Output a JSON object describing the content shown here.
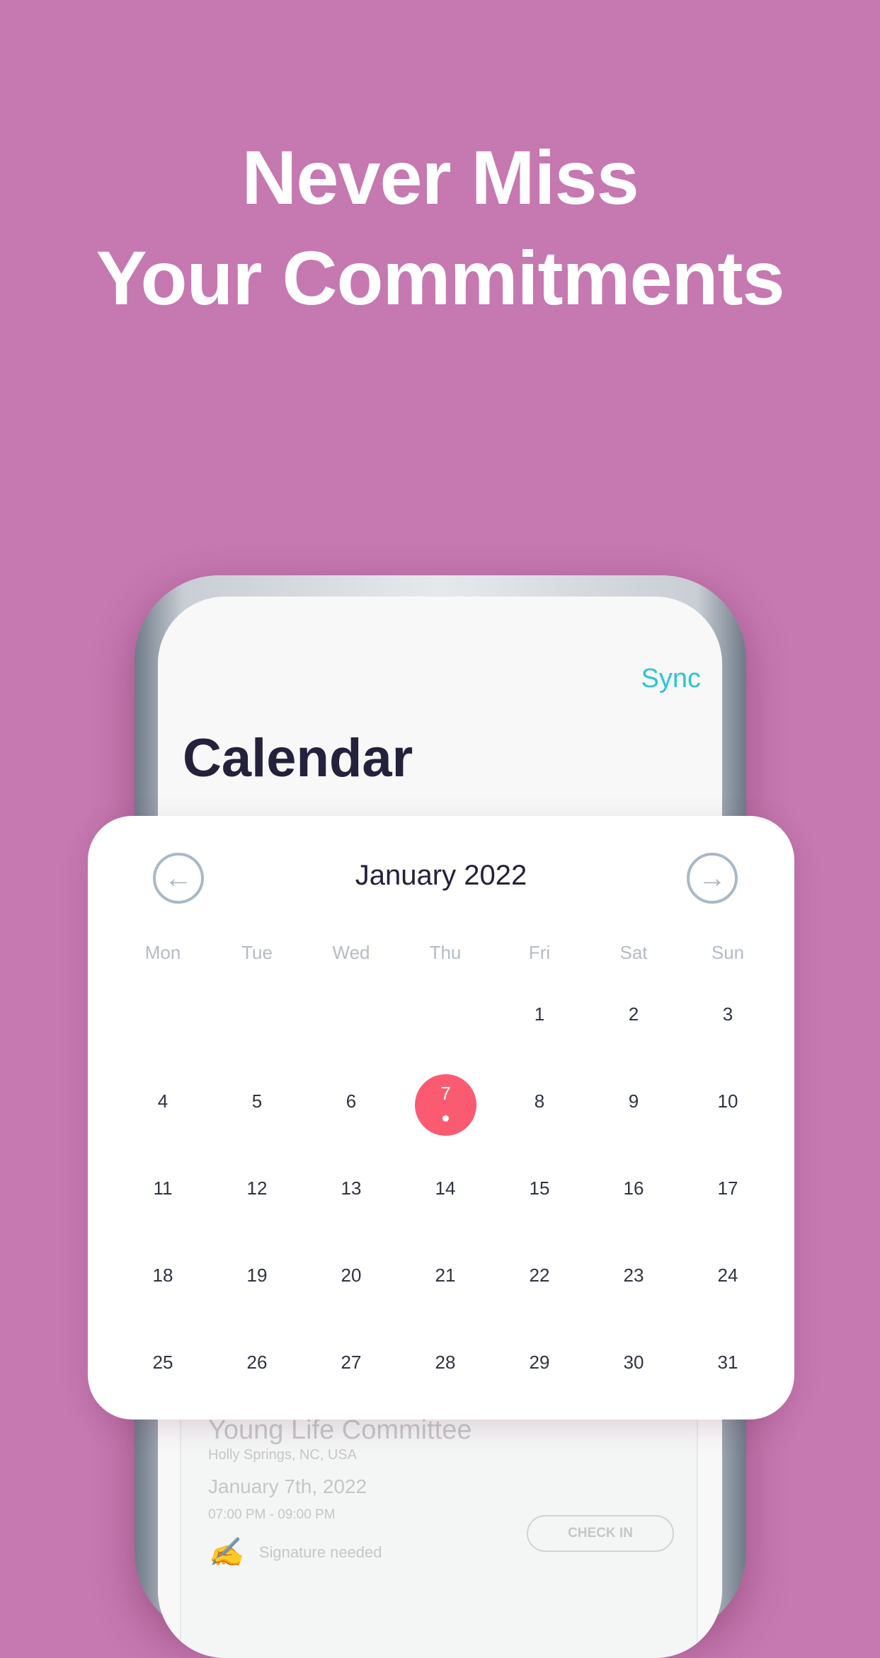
{
  "headline": {
    "line1": "Never Miss",
    "line2": "Your Commitments"
  },
  "app": {
    "sync_label": "Sync",
    "title": "Calendar"
  },
  "calendar": {
    "month_label": "January 2022",
    "prev_icon": "arrow-left-circle-icon",
    "next_icon": "arrow-right-circle-icon",
    "weekdays": [
      "Mon",
      "Tue",
      "Wed",
      "Thu",
      "Fri",
      "Sat",
      "Sun"
    ],
    "first_weekday_index": 4,
    "days_in_month": 31,
    "selected_day": 7,
    "selected_color": "#fb5b70",
    "event_dot_days": [
      7
    ]
  },
  "event": {
    "title": "Young Life Committee",
    "location": "Holly Springs, NC, USA",
    "date": "January 7th, 2022",
    "time": "07:00 PM - 09:00 PM",
    "signature_label": "Signature needed",
    "check_in_label": "CHECK IN"
  },
  "colors": {
    "background": "#c678b0",
    "accent": "#2cc6cf"
  }
}
